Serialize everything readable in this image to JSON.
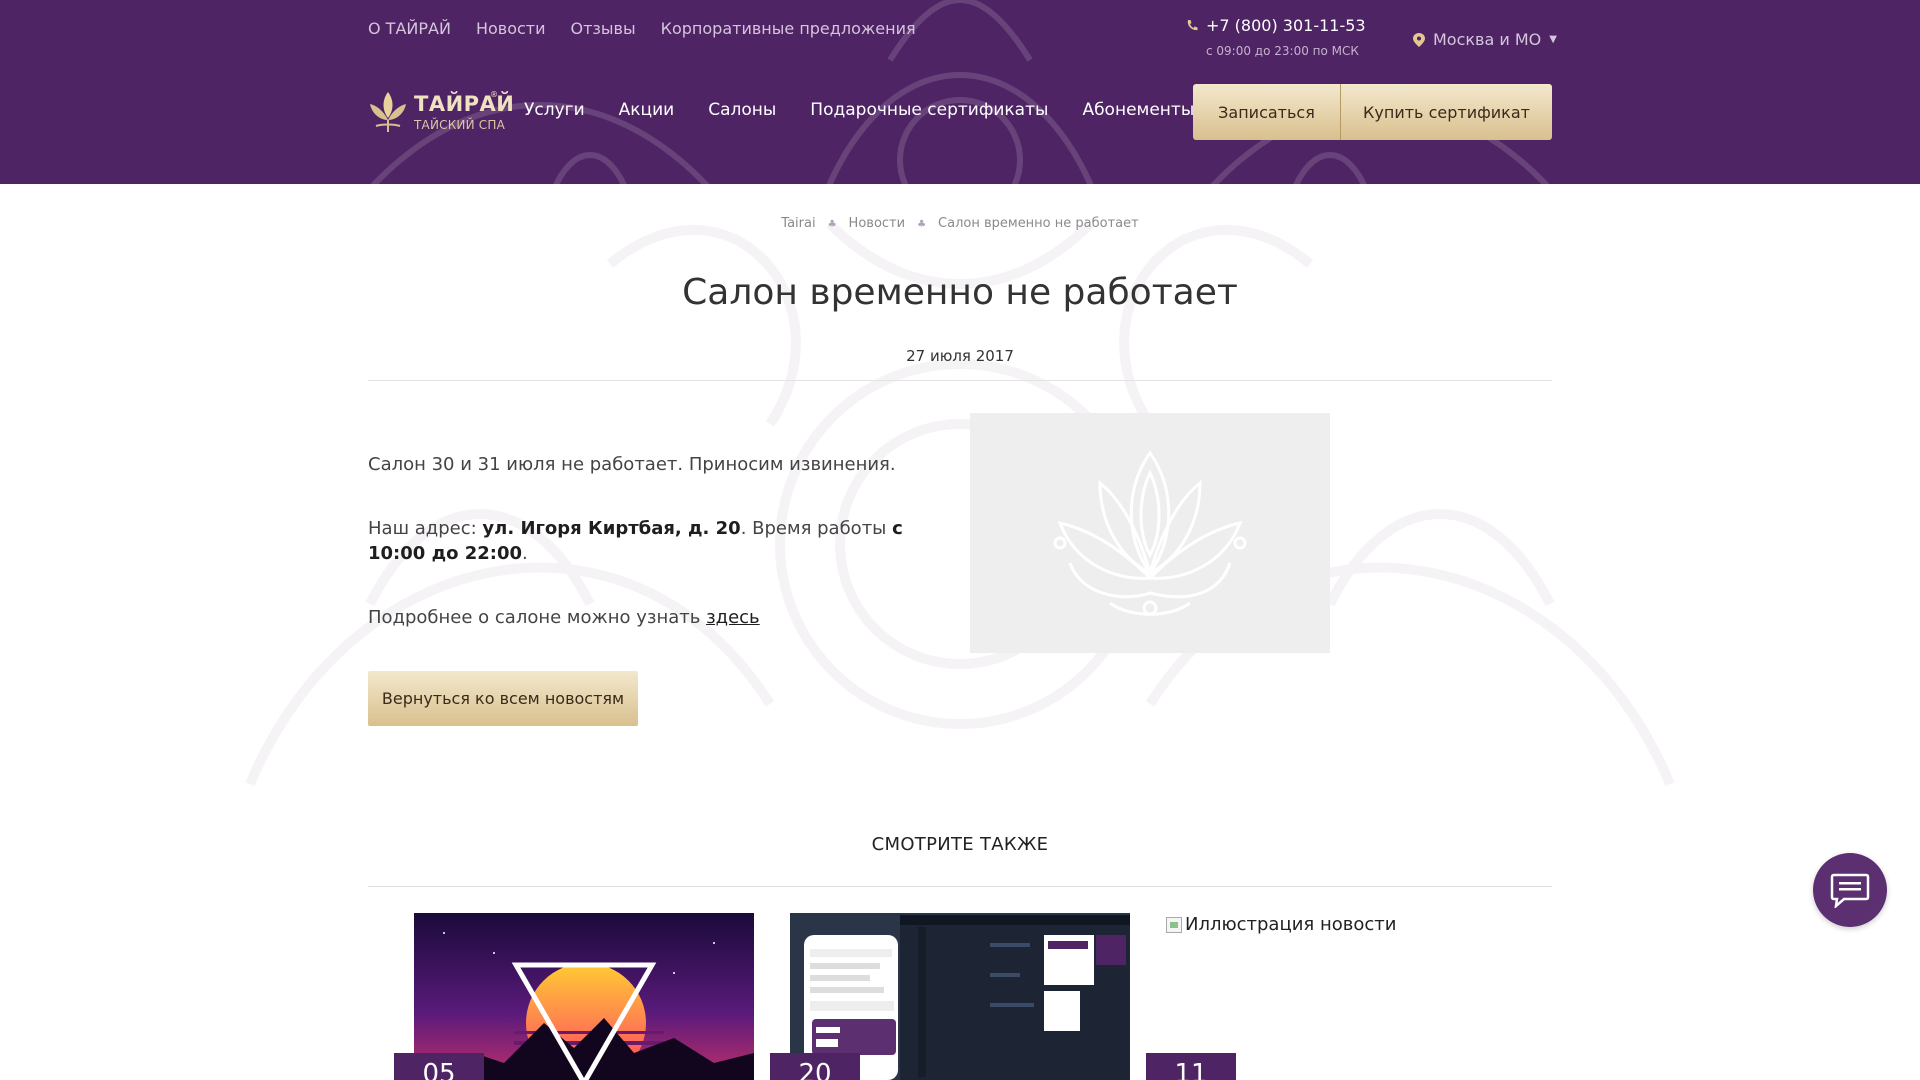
{
  "colors": {
    "header_bg": "#4f2464",
    "gold_light": "#f3e8cd",
    "gold_dark": "#d9c08e",
    "badge_bg": "#4f2464",
    "chat_bg": "#5b2f70"
  },
  "top_nav": {
    "items": [
      "О ТАЙРАЙ",
      "Новости",
      "Отзывы",
      "Корпоративные предложения"
    ]
  },
  "contact": {
    "phone_icon": "phone-icon",
    "phone": "+7 (800) 301-11-53",
    "hours": "с 09:00 до 23:00 по МСК"
  },
  "city": {
    "icon": "map-pin-icon",
    "label": "Москва и МО"
  },
  "logo": {
    "title": "ТАЙРАЙ",
    "subtitle": "ТАЙСКИЙ СПА",
    "reg": "®"
  },
  "main_nav": {
    "items": [
      "Услуги",
      "Акции",
      "Салоны",
      "Подарочные сертификаты",
      "Абонементы"
    ]
  },
  "header_buttons": {
    "book": "Записаться",
    "buy_certificate": "Купить сертификат"
  },
  "breadcrumb": {
    "items": [
      "Tairai",
      "Новости",
      "Салон временно не работает"
    ]
  },
  "article": {
    "title": "Салон временно не работает",
    "date": "27 июля 2017",
    "p1": "Салон 30 и 31 июля не работает. Приносим извинения.",
    "p2_a": "Наш адрес: ",
    "p2_addr": "ул. Игоря Киртбая, д. 20",
    "p2_b": ". Время работы ",
    "p2_hours": "с 10:00 до 22:00",
    "p2_c": ".",
    "p3_a": "Подробнее о салоне можно узнать ",
    "p3_link": "здесь",
    "back_button": "Вернуться ко всем новостям"
  },
  "see_also": {
    "heading": "СМОТРИТЕ ТАКЖЕ",
    "cards": [
      {
        "day": "05"
      },
      {
        "day": "20"
      },
      {
        "day": "11",
        "alt_text": "Иллюстрация новости"
      }
    ]
  },
  "chat": {
    "icon": "chat-bubble-icon"
  }
}
